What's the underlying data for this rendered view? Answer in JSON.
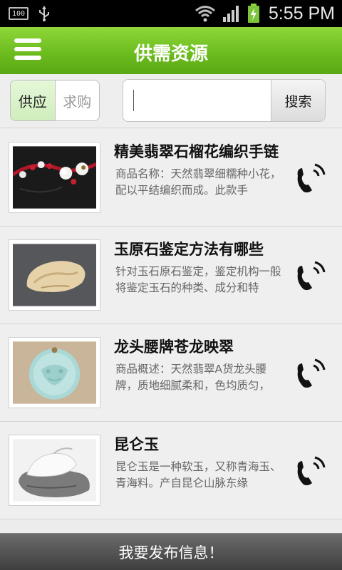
{
  "status_bar": {
    "battery_level": "100",
    "time": "5:55 PM"
  },
  "header": {
    "title": "供需资源",
    "menu_icon": "hamburger-menu-icon"
  },
  "filter": {
    "tabs": [
      {
        "label": "供应",
        "active": true
      },
      {
        "label": "求购",
        "active": false
      }
    ],
    "search_placeholder": "",
    "search_value": "",
    "search_button": "搜索"
  },
  "items": [
    {
      "title": "精美翡翠石榴花编织手链",
      "desc": "商品名称：天然翡翠细糯种小花，配以平结编织而成。此款手"
    },
    {
      "title": "玉原石鉴定方法有哪些",
      "desc": "针对玉石原石鉴定，鉴定机构一般将鉴定玉石的种类、成分和特"
    },
    {
      "title": "龙头腰牌苍龙映翠",
      "desc": "商品概述：天然翡翠A货龙头腰牌，质地细腻柔和，色均质匀，"
    },
    {
      "title": "昆仑玉",
      "desc": "昆仑玉是一种软玉，又称青海玉、青海料。产自昆仑山脉东缘"
    }
  ],
  "bottom_bar": {
    "label": "我要发布信息！"
  }
}
